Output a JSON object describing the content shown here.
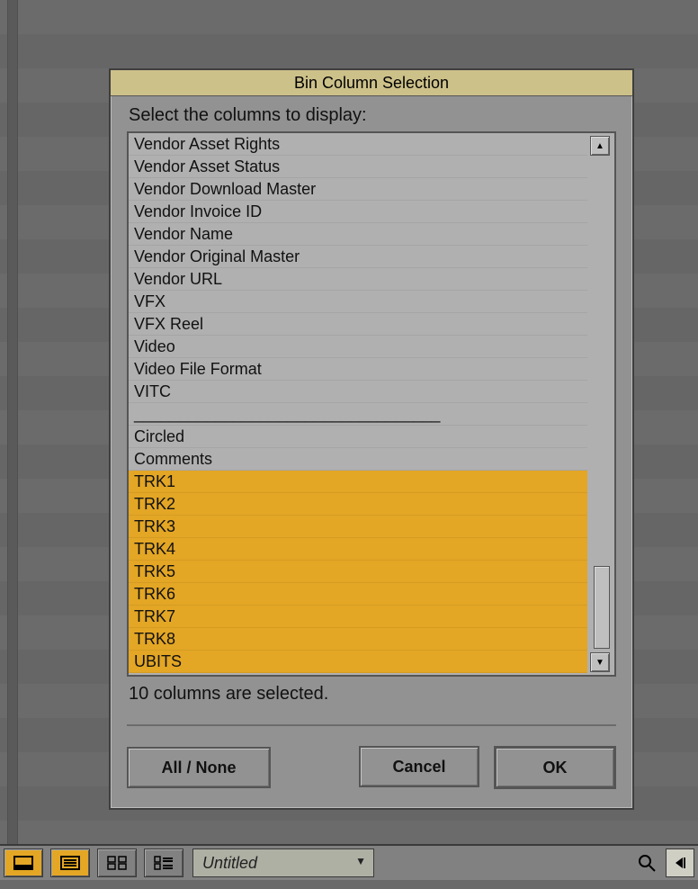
{
  "dialog": {
    "title": "Bin Column Selection",
    "prompt": "Select the columns to display:",
    "items": [
      {
        "label": "Vendor Asset Rights",
        "sel": false
      },
      {
        "label": "Vendor Asset Status",
        "sel": false
      },
      {
        "label": "Vendor Download Master",
        "sel": false
      },
      {
        "label": "Vendor Invoice ID",
        "sel": false
      },
      {
        "label": "Vendor Name",
        "sel": false
      },
      {
        "label": "Vendor Original Master",
        "sel": false
      },
      {
        "label": "Vendor URL",
        "sel": false
      },
      {
        "label": "VFX",
        "sel": false
      },
      {
        "label": "VFX Reel",
        "sel": false
      },
      {
        "label": "Video",
        "sel": false
      },
      {
        "label": "Video File Format",
        "sel": false
      },
      {
        "label": "VITC",
        "sel": false
      },
      {
        "label": "__________________________________",
        "sel": false
      },
      {
        "label": "Circled",
        "sel": false
      },
      {
        "label": "Comments",
        "sel": false
      },
      {
        "label": "TRK1",
        "sel": true
      },
      {
        "label": "TRK2",
        "sel": true
      },
      {
        "label": "TRK3",
        "sel": true
      },
      {
        "label": "TRK4",
        "sel": true
      },
      {
        "label": "TRK5",
        "sel": true
      },
      {
        "label": "TRK6",
        "sel": true
      },
      {
        "label": "TRK7",
        "sel": true
      },
      {
        "label": "TRK8",
        "sel": true
      },
      {
        "label": "UBITS",
        "sel": true
      }
    ],
    "status": "10 columns are selected.",
    "buttons": {
      "allnone": "All / None",
      "cancel": "Cancel",
      "ok": "OK"
    }
  },
  "toolbar": {
    "tab_label": "Untitled"
  },
  "colors": {
    "accent": "#e3a625"
  }
}
